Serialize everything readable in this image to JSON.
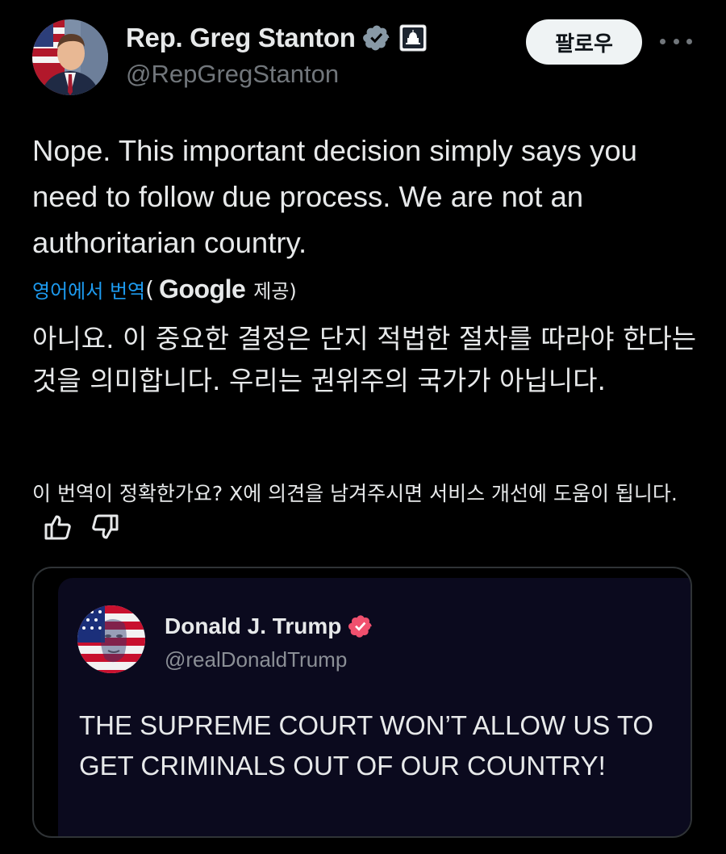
{
  "author": {
    "display_name": "Rep. Greg Stanton",
    "handle": "@RepGregStanton",
    "verified_badge": "verified-check-icon",
    "affiliation_badge": "capitol-building-icon"
  },
  "actions": {
    "follow_label": "팔로우",
    "more_icon": "more-options-icon"
  },
  "tweet": {
    "text": "Nope. This important decision simply says you need to follow due process. We are not an authoritarian country."
  },
  "translation": {
    "link_text": "영어에서 번역",
    "paren_open": "(",
    "provider": "Google",
    "provided_text": "제공)",
    "text": "아니요. 이 중요한 결정은 단지 적법한 절차를 따라야 한다는 것을 의미합니다. 우리는 권위주의 국가가 아닙니다.",
    "feedback_prompt": "이 번역이 정확한가요? X에 의견을 남겨주시면 서비스 개선에 도움이 됩니다."
  },
  "quoted_post": {
    "display_name": "Donald J. Trump",
    "handle": "@realDonaldTrump",
    "text": "THE SUPREME COURT WON’T ALLOW US TO GET CRIMINALS OUT OF OUR COUNTRY!"
  },
  "colors": {
    "background": "#000000",
    "link": "#1d9bf0",
    "secondary_text": "#71767b",
    "verified_blue": "#8899a6",
    "verified_pink": "#f0506e"
  }
}
